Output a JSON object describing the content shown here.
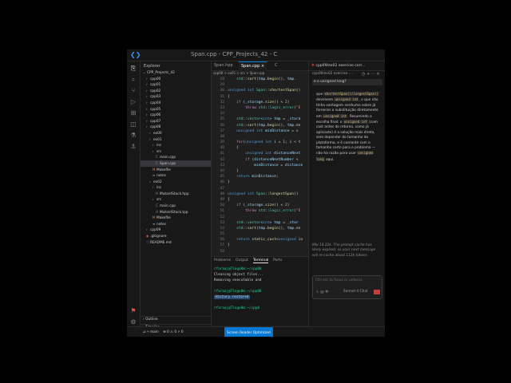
{
  "window": {
    "title": "Span.cpp - CPP_Projects_42 - C",
    "chat_title": "cpp09/ex02 exercise corr...",
    "chat_subtitle": "cpp09/ex02 exercise ...",
    "logo": "vscode-logo"
  },
  "sidebar": {
    "header": "Explorer",
    "root": "CPP_Projects_42",
    "items": [
      {
        "label": "cpp00",
        "kind": "folder",
        "depth": 1
      },
      {
        "label": "cpp01",
        "kind": "folder",
        "depth": 1
      },
      {
        "label": "cpp02",
        "kind": "folder",
        "depth": 1
      },
      {
        "label": "cpp03",
        "kind": "folder",
        "depth": 1
      },
      {
        "label": "cpp04",
        "kind": "folder",
        "depth": 1
      },
      {
        "label": "cpp05",
        "kind": "folder",
        "depth": 1
      },
      {
        "label": "cpp06",
        "kind": "folder",
        "depth": 1
      },
      {
        "label": "cpp07",
        "kind": "folder",
        "depth": 1
      },
      {
        "label": "cpp08",
        "kind": "folder",
        "depth": 1
      },
      {
        "label": "ex00",
        "kind": "folder",
        "depth": 2
      },
      {
        "label": "ex01",
        "kind": "folder",
        "depth": 2
      },
      {
        "label": "inc",
        "kind": "folder",
        "depth": 3
      },
      {
        "label": "src",
        "kind": "folder",
        "depth": 3
      },
      {
        "label": "main.cpp",
        "kind": "cpp",
        "depth": 4
      },
      {
        "label": "Span.cpp",
        "kind": "cpp",
        "depth": 4,
        "selected": true
      },
      {
        "label": "Makefile",
        "kind": "mk",
        "depth": 3
      },
      {
        "label": "notes",
        "kind": "txt",
        "depth": 3
      },
      {
        "label": "ex02",
        "kind": "folder",
        "depth": 2
      },
      {
        "label": "inc",
        "kind": "folder",
        "depth": 3
      },
      {
        "label": "MutantStack.hpp",
        "kind": "hpp",
        "depth": 4
      },
      {
        "label": "src",
        "kind": "folder",
        "depth": 3
      },
      {
        "label": "main.cpp",
        "kind": "cpp",
        "depth": 4
      },
      {
        "label": "MutantStack.tpp",
        "kind": "hpp",
        "depth": 4
      },
      {
        "label": "Makefile",
        "kind": "mk",
        "depth": 3
      },
      {
        "label": "notes",
        "kind": "txt",
        "depth": 3
      },
      {
        "label": "cpp09",
        "kind": "folder",
        "depth": 1
      },
      {
        "label": ".gitignore",
        "kind": "git",
        "depth": 1
      },
      {
        "label": "README.md",
        "kind": "md",
        "depth": 1
      }
    ],
    "outline": "Outline",
    "timeline": "Timeline"
  },
  "editor": {
    "tabs": [
      "Span.hpp",
      "Span.cpp",
      "C"
    ],
    "active_tab": 1,
    "breadcrumb": "cpp08 > ex01 > src > Span.cpp",
    "lines": [
      {
        "n": "28",
        "t": "    std::sort(tmp.begin(), tmp."
      },
      {
        "n": "29",
        "t": ""
      },
      {
        "n": "30",
        "t": "unsigned int Span::shortestSpan()"
      },
      {
        "n": "31",
        "t": "{"
      },
      {
        "n": "32",
        "t": "    if (_storage.size() < 2)"
      },
      {
        "n": "33",
        "t": "        throw std::logic_error(\"E"
      },
      {
        "n": "34",
        "t": ""
      },
      {
        "n": "35",
        "t": "    std::vector<int> tmp = _stora"
      },
      {
        "n": "36",
        "t": "    std::sort(tmp.begin(), tmp.en"
      },
      {
        "n": "37",
        "t": "    unsigned int minDistance = s"
      },
      {
        "n": "38",
        "t": ""
      },
      {
        "n": "39",
        "t": "    for(unsigned int i = 1; i < t"
      },
      {
        "n": "40",
        "t": "    {"
      },
      {
        "n": "41",
        "t": "        unsigned int distanceNext"
      },
      {
        "n": "42",
        "t": "        if (distanceNextNumber <"
      },
      {
        "n": "43",
        "t": "            minDistance = distance"
      },
      {
        "n": "44",
        "t": "    }"
      },
      {
        "n": "45",
        "t": "    return minDistance;"
      },
      {
        "n": "46",
        "t": "}"
      },
      {
        "n": "47",
        "t": ""
      },
      {
        "n": "48",
        "t": "unsigned int Span::longestSpan()"
      },
      {
        "n": "49",
        "t": "{"
      },
      {
        "n": "50",
        "t": "    if (_storage.size() < 2)"
      },
      {
        "n": "51",
        "t": "        throw std::logic_error(\"E"
      },
      {
        "n": "52",
        "t": ""
      },
      {
        "n": "53",
        "t": "    std::vector<int> tmp = _stor"
      },
      {
        "n": "54",
        "t": "    std::sort(tmp.begin(), tmp.en"
      },
      {
        "n": "55",
        "t": ""
      },
      {
        "n": "56",
        "t": "    return static_cast<unsigned in"
      },
      {
        "n": "57",
        "t": "}"
      },
      {
        "n": "58",
        "t": ""
      }
    ]
  },
  "panel": {
    "tabs": [
      "Problems",
      "Output",
      "Terminal",
      "Ports"
    ],
    "active_tab": 2,
    "terminal": [
      {
        "prompt": "rfaraaj@Tlogo8m:~/cpp08",
        "text": ""
      },
      {
        "prompt": "",
        "text": "Cleaning object files..."
      },
      {
        "prompt": "",
        "text": "Removing executable and"
      },
      {
        "prompt": "",
        "text": ""
      },
      {
        "prompt": "rfaraaj@Tlogo8m:~/cpp08",
        "text": ""
      },
      {
        "prompt": "",
        "text": "History restored",
        "boxed": true
      },
      {
        "prompt": "",
        "text": ""
      },
      {
        "prompt": "rfaraaj@Tlogo8m:~/cpp0",
        "text": ""
      }
    ]
  },
  "chat": {
    "question": "e o unsigned long?",
    "answer_parts": [
      {
        "t": "que "
      },
      {
        "t": "shortestSpan()/longestSpan()",
        "code": true
      },
      {
        "t": " devolvem "
      },
      {
        "t": "unsigned int",
        "code": true
      },
      {
        "t": ", o que não tinha vantagem nenhuma sobre já forneces a substituição diretamente em "
      },
      {
        "t": "unsigned int",
        "code": true
      },
      {
        "t": ". Resumindo a escolha final: o "
      },
      {
        "t": "unsigned int",
        "code": true
      },
      {
        "t": " (com cast antes do retorno, como já aplicaste) é a solução mais direta, sem depender do tamanho da plataforma, e é coerente com o tamanho certo para o problema — não há razão para usar "
      },
      {
        "t": "unsigned long",
        "code": true
      },
      {
        "t": " aqui."
      }
    ],
    "cache_note": "Mbi 18.22k. The prompt cache has likely expired, so your next message will re-cache about 112k tokens.",
    "input_placeholder": "Ctrl esc to focus or unfocus",
    "model": "Sonnet 4",
    "mode": "Chat"
  },
  "statusbar": {
    "branch": "main",
    "errors": "0",
    "warnings": "0",
    "ports": "0",
    "button": "Screen Reader Optimized"
  }
}
